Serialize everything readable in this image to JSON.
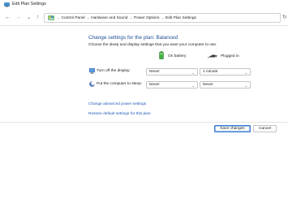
{
  "window": {
    "title": "Edit Plan Settings"
  },
  "nav": {
    "back_glyph": "←",
    "forward_glyph": "→",
    "recent_glyph": "⌄",
    "up_glyph": "↑",
    "refresh_glyph": "↻"
  },
  "breadcrumb": {
    "separator": "›",
    "items": [
      "Control Panel",
      "Hardware and Sound",
      "Power Options",
      "Edit Plan Settings"
    ]
  },
  "main": {
    "heading": "Change settings for the plan: Balanced",
    "subheading": "Choose the sleep and display settings that you want your computer to use.",
    "columns": {
      "on_battery": "On battery",
      "plugged_in": "Plugged in"
    },
    "rows": [
      {
        "label": "Turn off the display:",
        "on_battery": "Never",
        "plugged_in": "1 minute"
      },
      {
        "label": "Put the computer to sleep:",
        "on_battery": "Never",
        "plugged_in": "Never"
      }
    ],
    "chevron_glyph": "⌄",
    "links": {
      "advanced": "Change advanced power settings",
      "restore": "Restore default settings for this plan"
    }
  },
  "footer": {
    "save_label": "Save changes",
    "cancel_label": "Cancel"
  },
  "colors": {
    "link": "#1e5bb8",
    "heading": "#1e4f99",
    "primary_border": "#3a7bd5"
  }
}
